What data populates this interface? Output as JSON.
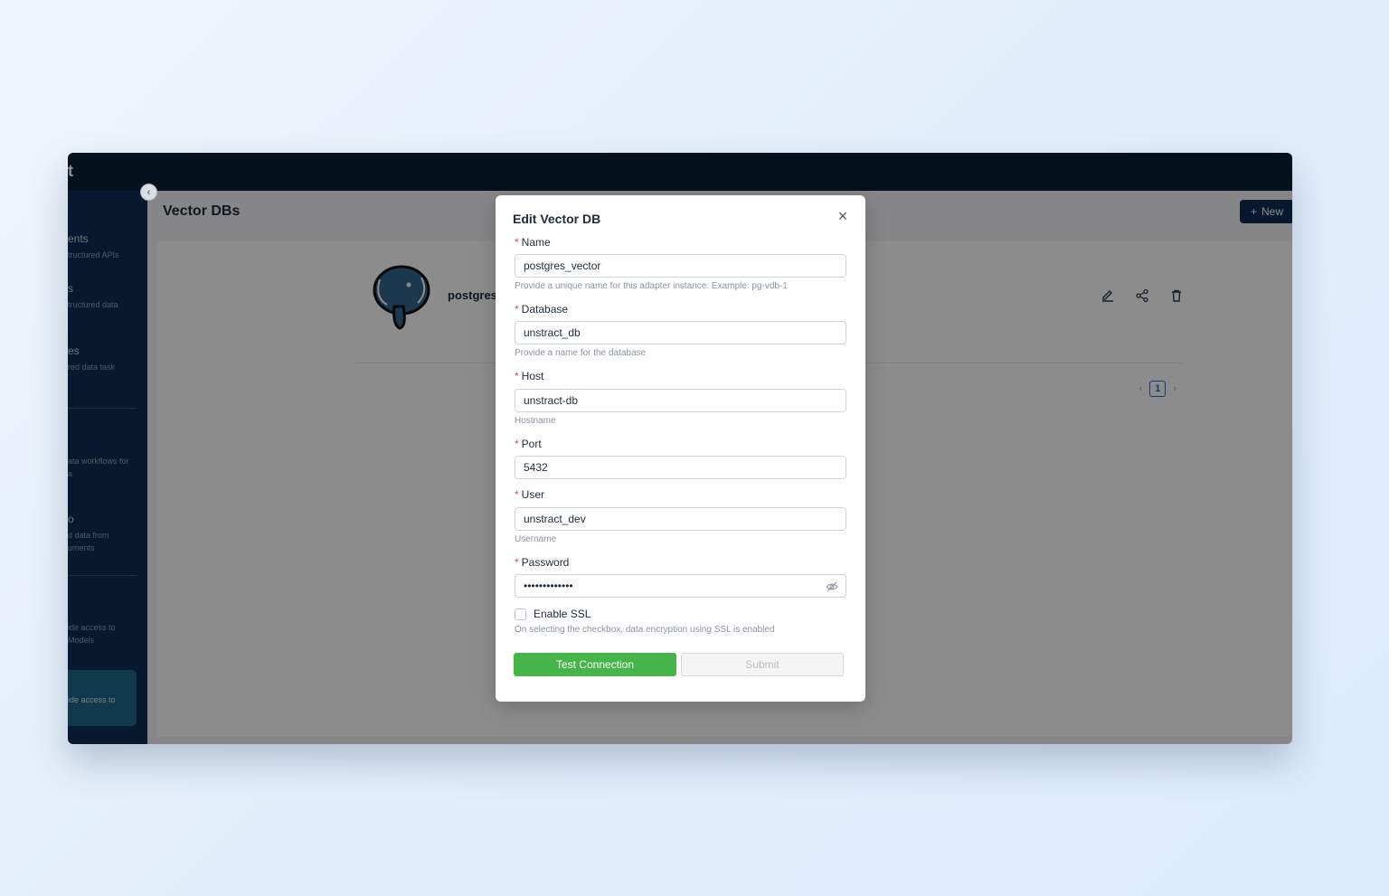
{
  "app": {
    "brand_fragment": "t"
  },
  "sidebar": {
    "items": [
      {
        "title": "ents",
        "subtitle": "tructured APIs"
      },
      {
        "title": "s",
        "subtitle": "tructured data"
      },
      {
        "title": "es",
        "subtitle": "red data task"
      },
      {
        "title": "",
        "subtitle": "ata workflows for\na"
      },
      {
        "title": "o",
        "subtitle": "d data from\numents"
      },
      {
        "title": "",
        "subtitle": "ide access to\nModels"
      }
    ],
    "active_subtitle": "ide access to"
  },
  "header": {
    "page_title": "Vector DBs",
    "new_button_label": "New"
  },
  "card": {
    "name": "postgres",
    "pagination": {
      "current": "1"
    }
  },
  "modal": {
    "title": "Edit Vector DB",
    "fields": {
      "name": {
        "label": "Name",
        "value": "postgres_vector",
        "help": "Provide a unique name for this adapter instance. Example: pg-vdb-1"
      },
      "database": {
        "label": "Database",
        "value": "unstract_db",
        "help": "Provide a name for the database"
      },
      "host": {
        "label": "Host",
        "value": "unstract-db",
        "help": "Hostname"
      },
      "port": {
        "label": "Port",
        "value": "5432"
      },
      "user": {
        "label": "User",
        "value": "unstract_dev",
        "help": "Username"
      },
      "password": {
        "label": "Password",
        "value": "•••••••••••••"
      }
    },
    "ssl": {
      "label": "Enable SSL",
      "help": "On selecting the checkbox, data encryption using SSL is enabled",
      "checked": false
    },
    "buttons": {
      "test": "Test Connection",
      "submit": "Submit"
    }
  },
  "colors": {
    "primary_nav": "#0f2f57",
    "success": "#45b549",
    "required": "#e5484d"
  }
}
